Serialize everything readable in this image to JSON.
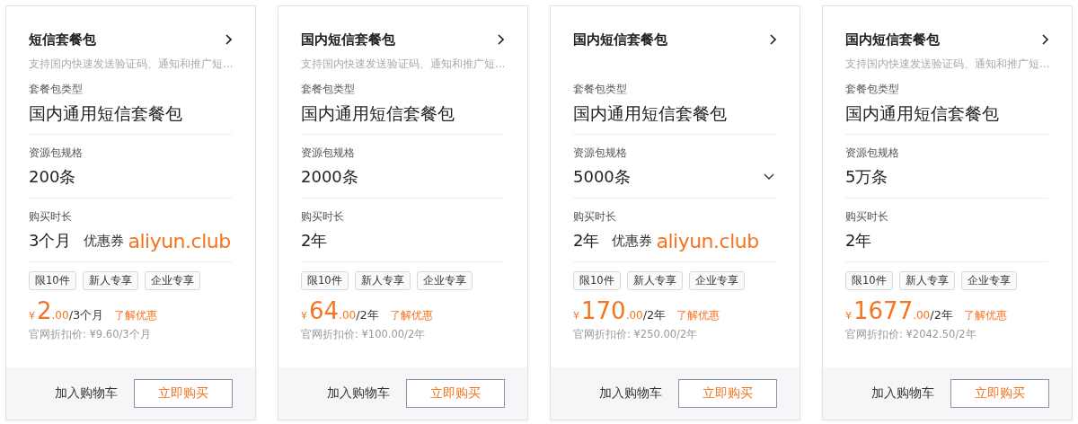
{
  "cards": [
    {
      "title": "短信套餐包",
      "description": "支持国内快速发送验证码、通知和推广短…",
      "type_label": "套餐包类型",
      "type_value": "国内通用短信套餐包",
      "spec_label": "资源包规格",
      "spec_value": "200条",
      "spec_dropdown": false,
      "duration_label": "购买时长",
      "duration_value": "3个月",
      "coupon": {
        "label": "优惠券",
        "site": "aliyun.club"
      },
      "tags": [
        "限10件",
        "新人专享",
        "企业专享"
      ],
      "currency": "¥",
      "price_int": "2",
      "price_dec": ".00",
      "period": "/3个月",
      "promo_link": "了解优惠",
      "list_price": "官网折扣价: ¥9.60/3个月",
      "cart_button": "加入购物车",
      "buy_button": "立即购买"
    },
    {
      "title": "国内短信套餐包",
      "description": "支持国内快速发送验证码、通知和推广短…",
      "type_label": "套餐包类型",
      "type_value": "国内通用短信套餐包",
      "spec_label": "资源包规格",
      "spec_value": "2000条",
      "spec_dropdown": false,
      "duration_label": "购买时长",
      "duration_value": "2年",
      "tags": [
        "限10件",
        "新人专享",
        "企业专享"
      ],
      "currency": "¥",
      "price_int": "64",
      "price_dec": ".00",
      "period": "/2年",
      "promo_link": "了解优惠",
      "list_price": "官网折扣价: ¥100.00/2年",
      "cart_button": "加入购物车",
      "buy_button": "立即购买"
    },
    {
      "title": "国内短信套餐包",
      "type_label": "套餐包类型",
      "type_value": "国内通用短信套餐包",
      "spec_label": "资源包规格",
      "spec_value": "5000条",
      "spec_dropdown": true,
      "duration_label": "购买时长",
      "duration_value": "2年",
      "coupon": {
        "label": "优惠券",
        "site": "aliyun.club"
      },
      "tags": [
        "限10件",
        "新人专享",
        "企业专享"
      ],
      "currency": "¥",
      "price_int": "170",
      "price_dec": ".00",
      "period": "/2年",
      "promo_link": "了解优惠",
      "list_price": "官网折扣价: ¥250.00/2年",
      "cart_button": "加入购物车",
      "buy_button": "立即购买"
    },
    {
      "title": "国内短信套餐包",
      "description": "支持国内快速发送验证码、通知和推广短…",
      "type_label": "套餐包类型",
      "type_value": "国内通用短信套餐包",
      "spec_label": "资源包规格",
      "spec_value": "5万条",
      "spec_dropdown": false,
      "duration_label": "购买时长",
      "duration_value": "2年",
      "tags": [
        "限10件",
        "新人专享",
        "企业专享"
      ],
      "currency": "¥",
      "price_int": "1677",
      "price_dec": ".00",
      "period": "/2年",
      "promo_link": "了解优惠",
      "list_price": "官网折扣价: ¥2042.50/2年",
      "cart_button": "加入购物车",
      "buy_button": "立即购买"
    }
  ]
}
